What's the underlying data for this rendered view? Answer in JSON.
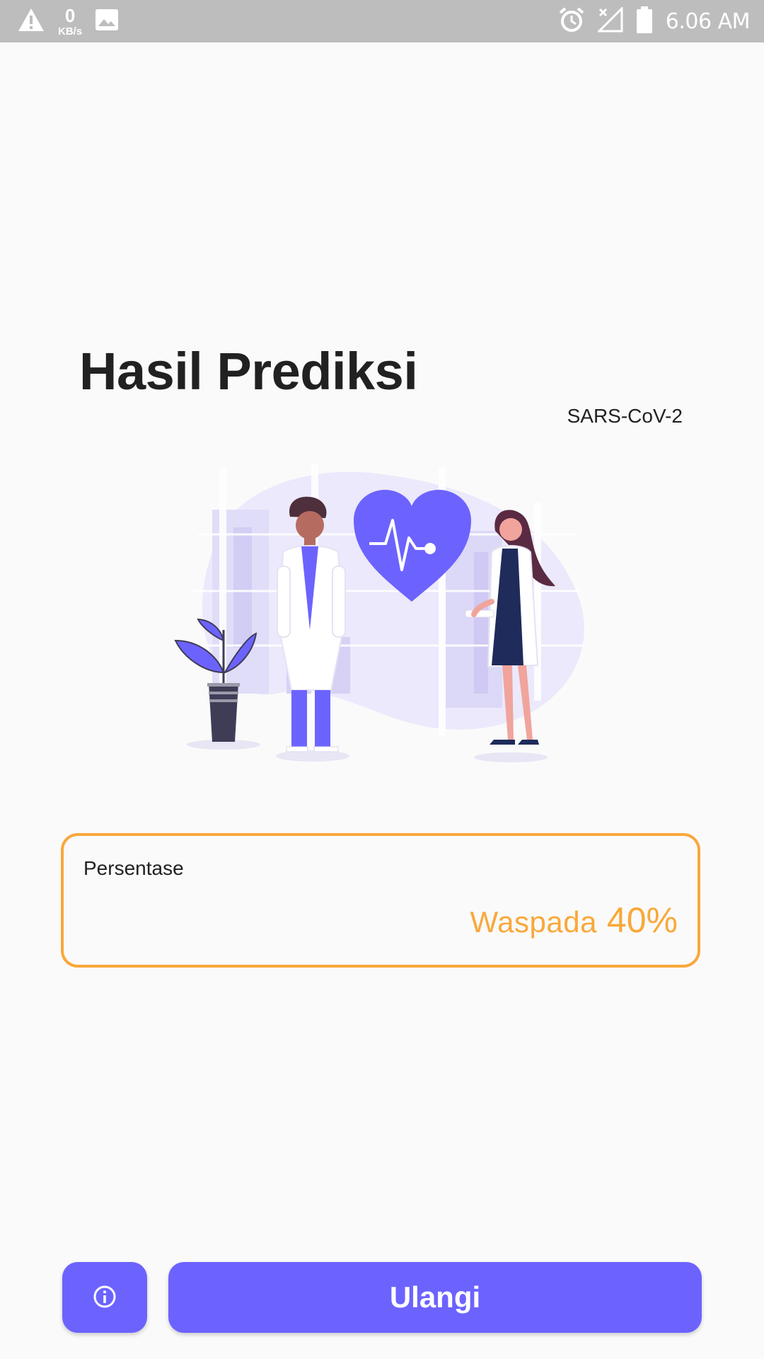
{
  "status_bar": {
    "net_speed_value": "0",
    "net_speed_unit": "KB/s",
    "time": "6.06 AM",
    "icons": [
      "warning-icon",
      "image-icon",
      "alarm-icon",
      "signal-off-icon",
      "battery-icon"
    ]
  },
  "header": {
    "title": "Hasil Prediksi",
    "subtitle": "SARS-CoV-2"
  },
  "illustration": {
    "name": "doctors-heart-illustration"
  },
  "result": {
    "label": "Persentase",
    "status": "Waspada",
    "percent": "40%",
    "accent_color": "#f9a83a"
  },
  "actions": {
    "info_icon": "info-icon",
    "retry_label": "Ulangi",
    "button_color": "#6c63ff"
  }
}
